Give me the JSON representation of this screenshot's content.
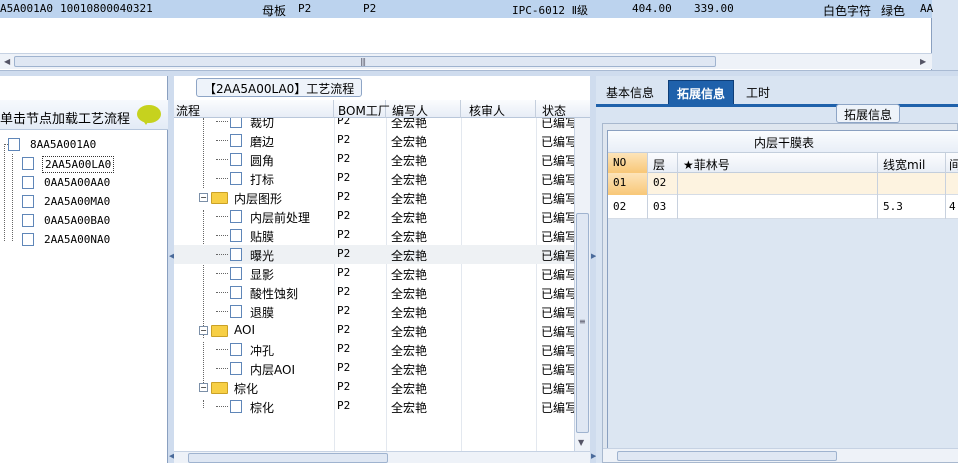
{
  "top_grid": {
    "row": {
      "code": "A5A001A0",
      "number": "10010800040321",
      "board_type": "母板",
      "factory1": "P2",
      "factory2": "P2",
      "grade": "IPC-6012 Ⅱ级",
      "value1": "404.00",
      "value2": "339.00",
      "char_color": "白色字符",
      "mask_color": "绿色",
      "tail": "AA"
    }
  },
  "left_panel": {
    "header": "单击节点加载工艺流程",
    "nodes": [
      {
        "label": "8AA5A001A0",
        "level": 0
      },
      {
        "label": "2AA5A00LA0",
        "level": 1,
        "selected": true
      },
      {
        "label": "0AA5A00AA0",
        "level": 1
      },
      {
        "label": "2AA5A00MA0",
        "level": 1
      },
      {
        "label": "0AA5A00BA0",
        "level": 1
      },
      {
        "label": "2AA5A00NA0",
        "level": 1
      }
    ]
  },
  "mid_panel": {
    "caption": "【2AA5A00LA0】工艺流程",
    "columns": [
      "流程",
      "BOM工厂",
      "编写人",
      "核审人",
      "状态"
    ],
    "rows": [
      {
        "name": "裁切",
        "level": 1,
        "factory": "P2",
        "author": "全宏艳",
        "reviewer": "",
        "status": "已编写"
      },
      {
        "name": "磨边",
        "level": 1,
        "factory": "P2",
        "author": "全宏艳",
        "reviewer": "",
        "status": "已编写"
      },
      {
        "name": "圆角",
        "level": 1,
        "factory": "P2",
        "author": "全宏艳",
        "reviewer": "",
        "status": "已编写"
      },
      {
        "name": "打标",
        "level": 1,
        "factory": "P2",
        "author": "全宏艳",
        "reviewer": "",
        "status": "已编写"
      },
      {
        "name": "内层图形",
        "level": 0,
        "factory": "P2",
        "author": "全宏艳",
        "reviewer": "",
        "status": "已编写"
      },
      {
        "name": "内层前处理",
        "level": 1,
        "factory": "P2",
        "author": "全宏艳",
        "reviewer": "",
        "status": "已编写"
      },
      {
        "name": "贴膜",
        "level": 1,
        "factory": "P2",
        "author": "全宏艳",
        "reviewer": "",
        "status": "已编写"
      },
      {
        "name": "曝光",
        "level": 1,
        "factory": "P2",
        "author": "全宏艳",
        "reviewer": "",
        "status": "已编写",
        "highlight": true
      },
      {
        "name": "显影",
        "level": 1,
        "factory": "P2",
        "author": "全宏艳",
        "reviewer": "",
        "status": "已编写"
      },
      {
        "name": "酸性蚀刻",
        "level": 1,
        "factory": "P2",
        "author": "全宏艳",
        "reviewer": "",
        "status": "已编写"
      },
      {
        "name": "退膜",
        "level": 1,
        "factory": "P2",
        "author": "全宏艳",
        "reviewer": "",
        "status": "已编写"
      },
      {
        "name": "AOI",
        "level": 0,
        "factory": "P2",
        "author": "全宏艳",
        "reviewer": "",
        "status": "已编写"
      },
      {
        "name": "冲孔",
        "level": 1,
        "factory": "P2",
        "author": "全宏艳",
        "reviewer": "",
        "status": "已编写"
      },
      {
        "name": "内层AOI",
        "level": 1,
        "factory": "P2",
        "author": "全宏艳",
        "reviewer": "",
        "status": "已编写"
      },
      {
        "name": "棕化",
        "level": 0,
        "factory": "P2",
        "author": "全宏艳",
        "reviewer": "",
        "status": "已编写"
      },
      {
        "name": "棕化",
        "level": 1,
        "factory": "P2",
        "author": "全宏艳",
        "reviewer": "",
        "status": "已编写"
      }
    ]
  },
  "right_panel": {
    "tabs": [
      {
        "label": "基本信息",
        "active": false
      },
      {
        "label": "拓展信息",
        "active": true
      },
      {
        "label": "工时",
        "active": false
      }
    ],
    "section_caption": "拓展信息",
    "table_title": "内层干膜表",
    "columns": [
      "NO",
      "层",
      "★菲林号",
      "线宽mil",
      "间"
    ],
    "rows": [
      {
        "no": "01",
        "layer": "02",
        "film": "",
        "width": "",
        "gap": "",
        "selected": true
      },
      {
        "no": "02",
        "layer": "03",
        "film": "",
        "width": "5.3",
        "gap": "4"
      }
    ]
  },
  "colors": {
    "accent": "#1f61ab",
    "row_highlight": "#bcd3ee",
    "folder": "#f7cf45"
  }
}
